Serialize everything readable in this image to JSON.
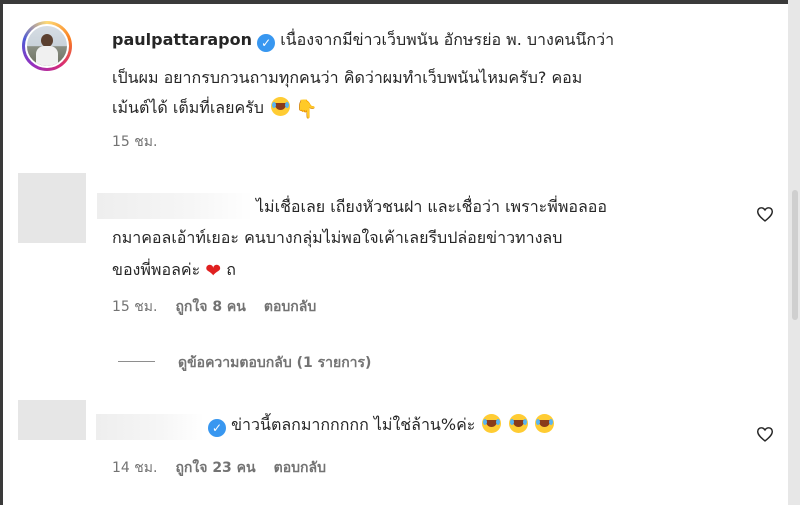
{
  "post": {
    "username": "paulpattarapon",
    "line1": "เนื่องจากมีข่าวเว็บพนัน อักษรย่อ พ. บางคนนึกว่า",
    "line2": "เป็นผม อยากรบกวนถามทุกคนว่า คิดว่าผมทำเว็บพนันไหมครับ? คอม",
    "line3": "เม้นต์ได้ เต็มที่เลยครับ",
    "time": "15 ชม."
  },
  "comments": [
    {
      "line1": "ไม่เชื่อเลย เถียงหัวชนฝา และเชื่อว่า เพราะพี่พอลออ",
      "line2": "กมาคอลเอ้าท์เยอะ คนบางกลุ่มไม่พอใจเค้าเลยรีบปล่อยข่าวทางลบ",
      "line3": "ของพี่พอลค่ะ",
      "line3_tail": "ถ",
      "time": "15 ชม.",
      "likes": "ถูกใจ 8 คน",
      "reply": "ตอบกลับ"
    },
    {
      "line1": "ข่าวนี้ตลกมากกกกก ไม่ใช่ล้าน%ค่ะ",
      "time": "14 ชม.",
      "likes": "ถูกใจ 23 คน",
      "reply": "ตอบกลับ"
    }
  ],
  "view_replies": "ดูข้อความตอบกลับ (1 รายการ)",
  "icons": {
    "verified": "verified-badge-icon",
    "heart": "heart-outline-icon",
    "laugh": "tears-of-joy-emoji",
    "point": "backhand-index-pointing-down-emoji",
    "red_heart": "red-heart-emoji"
  },
  "colors": {
    "text": "#262626",
    "meta": "#737373",
    "verified": "#3897f0"
  }
}
